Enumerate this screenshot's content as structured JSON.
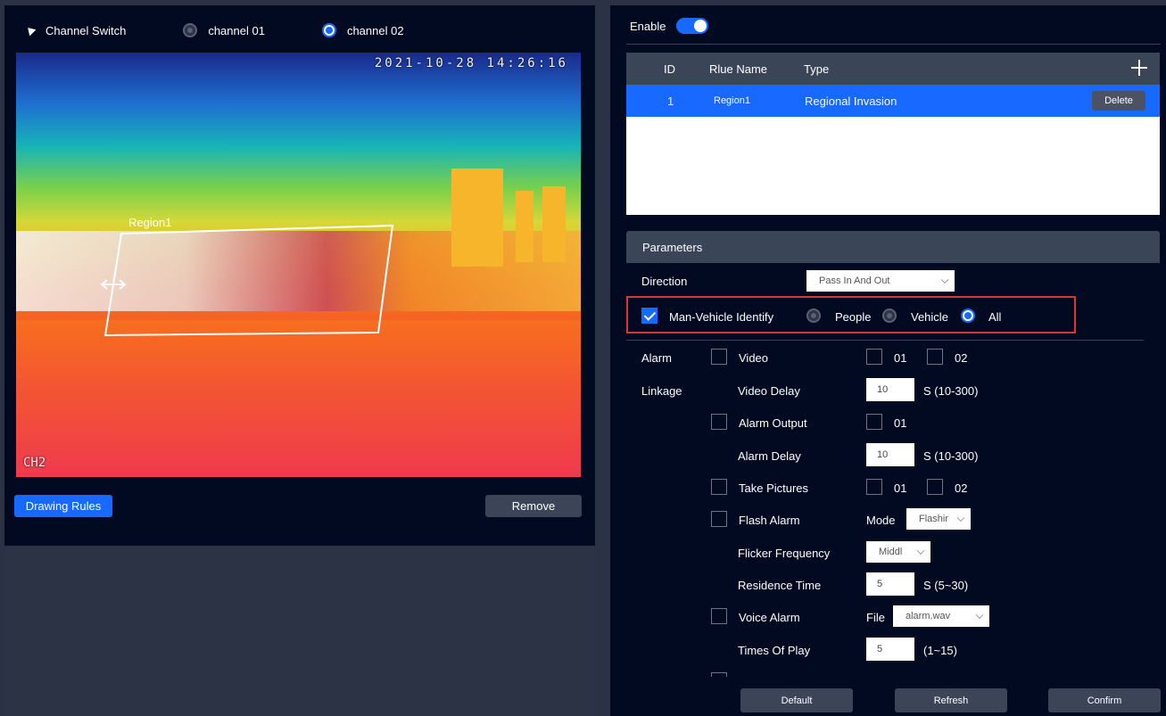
{
  "left": {
    "channel_switch_label": "Channel Switch",
    "channels": [
      "channel 01",
      "channel 02"
    ],
    "selected_channel": "channel 02",
    "video": {
      "timestamp": "2021-10-28 14:26:16",
      "channel_osd": "CH2",
      "region_label": "Region1"
    },
    "drawing_rules_label": "Drawing Rules",
    "remove_label": "Remove"
  },
  "right": {
    "enable_label": "Enable",
    "enabled": true,
    "table": {
      "headers": [
        "ID",
        "Rlue Name",
        "Type"
      ],
      "rows": [
        {
          "id": "1",
          "name": "Region1",
          "type": "Regional Invasion",
          "action": "Delete"
        }
      ]
    },
    "parameters": {
      "title": "Parameters",
      "direction_label": "Direction",
      "direction_value": "Pass In And Out",
      "man_vehicle_label": "Man-Vehicle Identify",
      "man_vehicle_checked": true,
      "target_options": [
        "People",
        "Vehicle",
        "All"
      ],
      "target_selected": "All",
      "alarm_label": "Alarm",
      "linkage_label": "Linkage",
      "video_label": "Video",
      "video_ch": [
        "01",
        "02"
      ],
      "video_delay_label": "Video Delay",
      "video_delay_value": "10",
      "video_delay_range": "S (10-300)",
      "alarm_output_label": "Alarm Output",
      "alarm_output_ch": "01",
      "alarm_delay_label": "Alarm Delay",
      "alarm_delay_value": "10",
      "alarm_delay_range": "S (10-300)",
      "take_pictures_label": "Take Pictures",
      "take_pictures_ch": [
        "01",
        "02"
      ],
      "flash_alarm_label": "Flash Alarm",
      "mode_label": "Mode",
      "mode_value": "Flashir",
      "flicker_label": "Flicker Frequency",
      "flicker_value": "Middl",
      "residence_label": "Residence Time",
      "residence_value": "5",
      "residence_range": "S (5~30)",
      "voice_alarm_label": "Voice Alarm",
      "file_label": "File",
      "file_value": "alarm.wav",
      "times_label": "Times Of Play",
      "times_value": "5",
      "times_range": "(1~15)"
    },
    "buttons": {
      "default": "Default",
      "refresh": "Refresh",
      "confirm": "Confirm"
    }
  },
  "colors": {
    "accent": "#1769ff",
    "panel": "#020a22",
    "background": "#2b3245",
    "highlight_border": "#e0332e"
  }
}
